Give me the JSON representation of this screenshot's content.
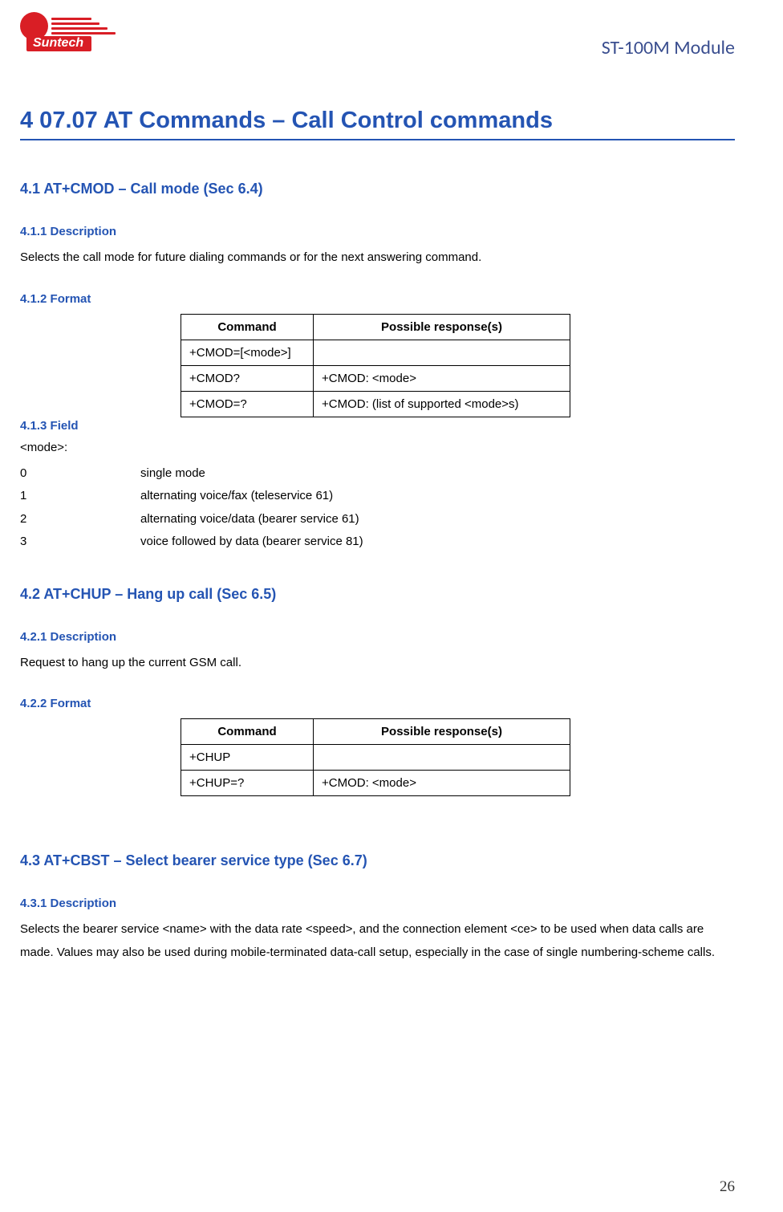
{
  "header": {
    "logo_text": "Suntech",
    "doc_title": "ST-100M Module"
  },
  "main_heading": "4 07.07 AT Commands – Call Control commands",
  "sections": [
    {
      "heading": "4.1 AT+CMOD – Call mode (Sec 6.4)",
      "desc_heading": "4.1.1 Description",
      "desc_text": "Selects the call mode for future dialing commands or for the next answering command.",
      "format_heading": "4.1.2 Format",
      "table": {
        "h1": "Command",
        "h2": "Possible response(s)",
        "rows": [
          {
            "c1": "+CMOD=[<mode>]",
            "c2": ""
          },
          {
            "c1": "+CMOD?",
            "c2": "+CMOD: <mode>"
          },
          {
            "c1": "+CMOD=?",
            "c2": "+CMOD: (list of supported <mode>s)"
          }
        ]
      },
      "field_heading": "4.1.3 Field",
      "field_label": "<mode>:",
      "fields": [
        {
          "k": "0",
          "v": "single mode"
        },
        {
          "k": "1",
          "v": "alternating voice/fax (teleservice 61)"
        },
        {
          "k": "2",
          "v": "alternating voice/data (bearer service 61)"
        },
        {
          "k": "3",
          "v": "voice followed by data (bearer service 81)"
        }
      ]
    },
    {
      "heading": "4.2 AT+CHUP – Hang up call (Sec 6.5)",
      "desc_heading": "4.2.1 Description",
      "desc_text": "Request to hang up the current GSM call.",
      "format_heading": "4.2.2 Format",
      "table": {
        "h1": "Command",
        "h2": "Possible response(s)",
        "rows": [
          {
            "c1": "+CHUP",
            "c2": ""
          },
          {
            "c1": "+CHUP=?",
            "c2": "+CMOD: <mode>"
          }
        ]
      }
    },
    {
      "heading": "4.3 AT+CBST – Select bearer service type (Sec 6.7)",
      "desc_heading": "4.3.1 Description",
      "desc_text": "Selects the bearer service <name> with the data rate <speed>, and the connection element <ce> to be used when data calls are made. Values may also be used during mobile-terminated data-call setup, especially in the case of single numbering-scheme calls."
    }
  ],
  "page_number": "26"
}
